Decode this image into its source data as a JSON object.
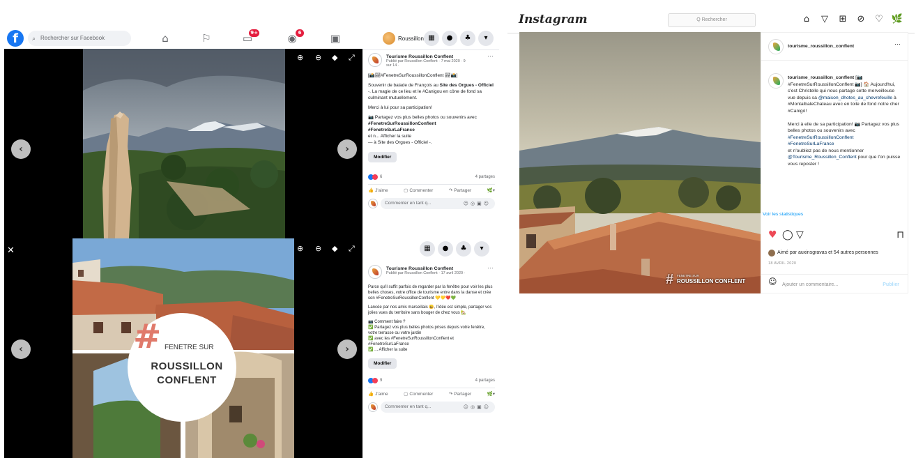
{
  "facebook": {
    "search_placeholder": "Rechercher sur Facebook",
    "profile_name": "Roussillon",
    "notif_badge_watch": "9+",
    "notif_badge_groups": "6",
    "post1": {
      "page_name": "Tourisme Roussillon Conflent",
      "meta": "Publié par Roussillon Conflent · 7 mai 2020 · 9 sur 14 ·",
      "hashtag_line": "[📸🏞#FenetreSurRoussillonConflent 🏞📸]",
      "text1_a": "Souvenir de balade de François au ",
      "text1_b": "Site des Orgues - Officiel",
      "text1_c": " -. La magie de ce lieu et le #Canigou en cône de fond sa culminant mutuellement.",
      "text2": "Merci à lui pour sa participation!",
      "text3": "📷 Partagez vos plus belles photos ou souvenirs avec",
      "tag1": "#FenetreSurRoussillonConflent",
      "tag2": "#FenetreSurLaFrance",
      "more": "et n... Afficher la suite",
      "site_link": "— à Site des Orgues - Officiel -.",
      "edit": "Modifier",
      "reactions_count": "6",
      "shares": "4 partages",
      "like": "J'aime",
      "comment": "Commenter",
      "share": "Partager",
      "comment_placeholder": "Commenter en tant q..."
    },
    "post2": {
      "page_name": "Tourisme Roussillon Conflent",
      "meta": "Publié par Roussillon Conflent · 17 avril 2020 ·",
      "text1": "Parce qu'il suffit parfois de regarder par la fenêtre pour voir les plus belles choses, votre office de tourisme entre dans la danse et crée son #FenetreSurRoussillonConflent 💛💛❤️💚",
      "text2": "Lancée par nos amis marseillais 😀, l'idée est simple, partager vos jolies vues du territoire sans bouger de chez vous 🏡",
      "text3": "📷 Comment faire ?",
      "text4": "✅ Partagez vos plus belles photos prises depuis votre fenêtre, votre terrasse ou votre jardin",
      "text5": "✅ avec les #FenetreSurRoussillonConflent et #FenetreSurLaFrance",
      "text6": "✅ ... Afficher la suite",
      "edit": "Modifier",
      "reactions_count": "9",
      "shares": "4 partages",
      "like": "J'aime",
      "comment": "Commenter",
      "share": "Partager",
      "comment_placeholder": "Commenter en tant q..."
    },
    "banner": {
      "hash": "#",
      "line1": "FENETRE SUR",
      "line2": "ROUSSILLON",
      "line3": "CONFLENT"
    }
  },
  "instagram": {
    "logo": "Instagram",
    "search_placeholder": "Q Rechercher",
    "account": "tourisme_roussillon_conflent",
    "caption_user": "tourisme_roussillon_conflent",
    "caption1": " [📷 #FenetreSurRoussillonConflent 📷] 🏠 Aujourd'hui, c'est Christelle qui nous partage cette merveilleuse vue depuis sa ",
    "caption_mention1": "@maison_dhotes_au_chevrefeuille",
    "caption2": " à #MontalbaleChateau avec en toile de fond notre cher #Canigó!",
    "caption3": "Merci à elle de sa participation! 📷 Partagez vos plus belles photos ou souvenirs avec",
    "caption_tag1": "#FenetreSurRoussillonConflent",
    "caption_tag2": "#FenetreSurLaFrance",
    "caption4": "et n'oubliez pas de nous mentionner ",
    "caption_mention2": "@Tourisme_Roussillon_Conflent",
    "caption5": " pour que l'on puisse vous reposter !",
    "stats": "Voir les statistiques",
    "likes": "Aimé par auxinsgravas et 54 autres personnes",
    "date": "18 AVRIL 2020",
    "comment_placeholder": "Ajouter un commentaire...",
    "publish": "Publier",
    "watermark1": "FENETRE SUR",
    "watermark2": "ROUSSILLON CONFLENT",
    "watermark_hash": "#"
  }
}
